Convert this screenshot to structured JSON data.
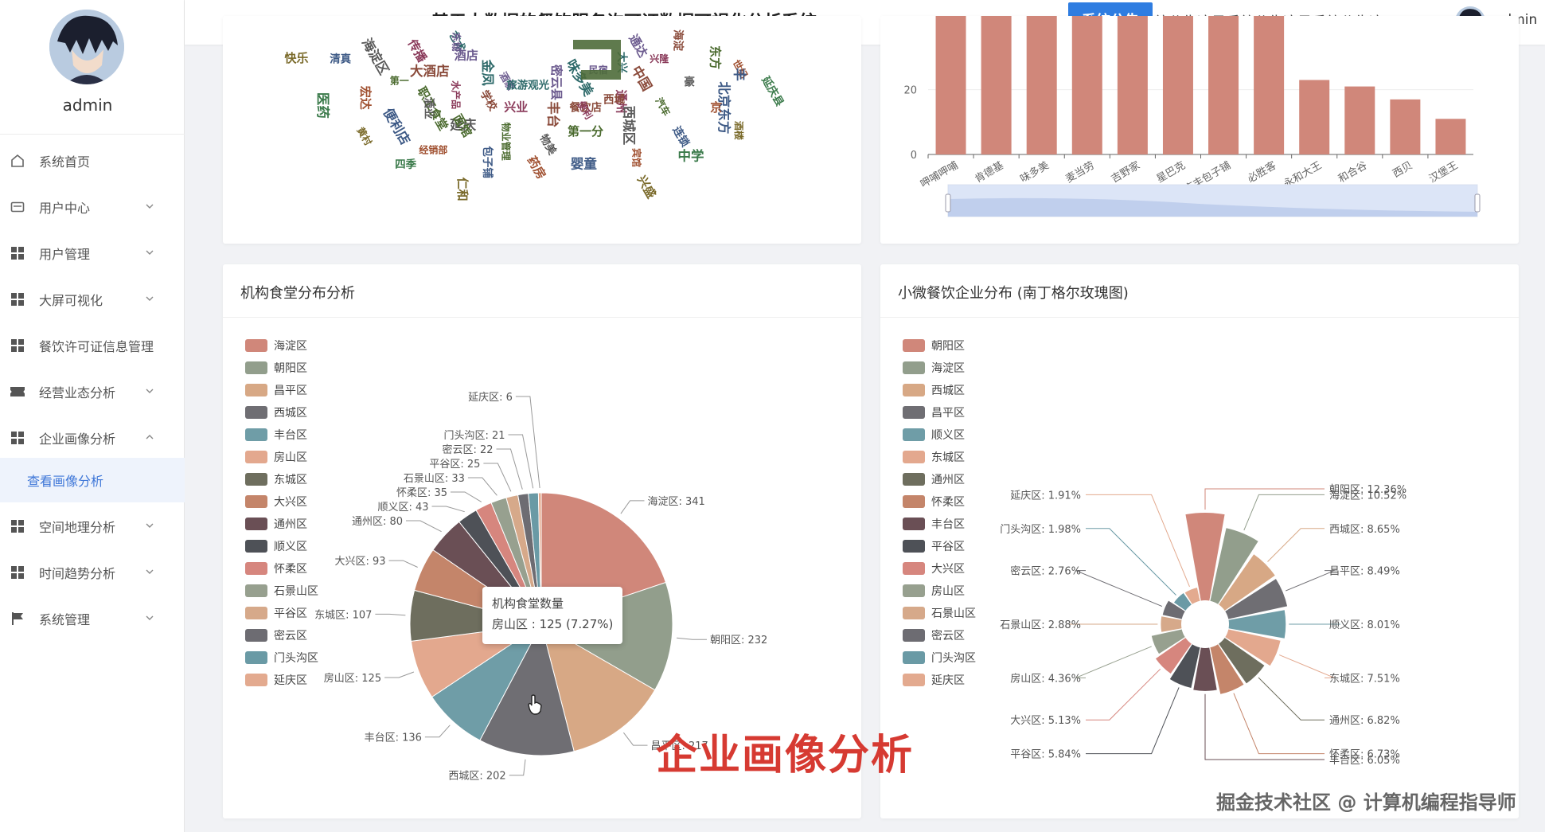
{
  "app": {
    "title": "基于大数据的餐饮服务许可证数据可视化分析系统",
    "notice_button": "系统公告",
    "notice_text": "统公告这是系统公告这是系统公告这是系统公",
    "username": "admin"
  },
  "sidebar": {
    "username": "admin",
    "items": [
      {
        "label": "系统首页",
        "icon": "home-icon"
      },
      {
        "label": "用户中心",
        "icon": "id-card-icon"
      },
      {
        "label": "用户管理",
        "icon": "grid-icon"
      },
      {
        "label": "大屏可视化",
        "icon": "grid-icon"
      },
      {
        "label": "餐饮许可证信息管理",
        "icon": "grid-icon"
      },
      {
        "label": "经营业态分析",
        "icon": "ticket-icon"
      },
      {
        "label": "企业画像分析",
        "icon": "grid-icon"
      },
      {
        "label": "查看画像分析",
        "icon": ""
      },
      {
        "label": "空间地理分析",
        "icon": "grid-icon"
      },
      {
        "label": "时间趋势分析",
        "icon": "grid-icon"
      },
      {
        "label": "系统管理",
        "icon": "flag-icon"
      }
    ]
  },
  "wordcloud": {
    "words": [
      "咨询",
      "餐饮店",
      "职工食堂",
      "北京东方",
      "海淀",
      "艺术",
      "通州",
      "延庆",
      "世纪",
      "昌平区",
      "酒店",
      "中国",
      "物业管理",
      "清真",
      "兴盛",
      "金凤",
      "兴隆",
      "物美",
      "宏达",
      "中学",
      "酒家",
      "海淀",
      "第一分",
      "便利店",
      "酒楼",
      "旅游观光",
      "传播",
      "西城区",
      "经销部",
      "延庆县",
      "密云县",
      "大酒店",
      "汽车",
      "包子铺",
      "快乐",
      "味多美",
      "水产品",
      "豪",
      "药房",
      "医药",
      "民宿",
      "学校",
      "东方",
      "婴童",
      "黄村",
      "大兴",
      "兴业",
      "海淀区",
      "宾馆",
      "四季",
      "通达",
      "丰台",
      "第一",
      "连锁",
      "仁和",
      "西餐",
      "便利",
      "酒业",
      "京",
      "食品",
      "东城",
      "西城",
      "面馆",
      "丰"
    ]
  },
  "top_bar_chart": {
    "chart_data": {
      "type": "bar",
      "categories": [
        "呷哺呷哺",
        "肯德基",
        "味多美",
        "麦当劳",
        "吉野家",
        "星巴克",
        "庆丰包子铺",
        "必胜客",
        "永和大王",
        "和合谷",
        "西贝",
        "汉堡王"
      ],
      "values": [
        45,
        45,
        45,
        45,
        45,
        45,
        45,
        45,
        23,
        21,
        17,
        11
      ],
      "yticks": [
        0,
        20
      ],
      "color": "#d0877a",
      "data_zoom": true
    }
  },
  "canteen_pie": {
    "title": "机构食堂分布分析",
    "chart_data": {
      "type": "pie",
      "series_name": "机构食堂数量",
      "labels": [
        "海淀区",
        "朝阳区",
        "昌平区",
        "西城区",
        "丰台区",
        "房山区",
        "东城区",
        "大兴区",
        "通州区",
        "顺义区",
        "怀柔区",
        "石景山区",
        "平谷区",
        "密云区",
        "门头沟区",
        "延庆区"
      ],
      "values": [
        341,
        232,
        217,
        202,
        136,
        125,
        107,
        93,
        80,
        43,
        35,
        33,
        25,
        22,
        21,
        6
      ],
      "colors": [
        "#d0877a",
        "#929e8c",
        "#d7a885",
        "#6f6e73",
        "#6f9da7",
        "#e3a88e",
        "#6e6e5e",
        "#c4856a",
        "#6a4f55",
        "#4e5157",
        "#d6867e",
        "#97a08f",
        "#d6a98a",
        "#6d6c72",
        "#6a9aa5",
        "#e3aa8f"
      ]
    },
    "tooltip": {
      "title": "机构食堂数量",
      "body": "房山区 : 125 (7.27%)"
    }
  },
  "rose_chart": {
    "title": "小微餐饮企业分布 (南丁格尔玫瑰图)",
    "chart_data": {
      "type": "pie",
      "rose": true,
      "labels": [
        "朝阳区",
        "海淀区",
        "西城区",
        "昌平区",
        "顺义区",
        "东城区",
        "通州区",
        "怀柔区",
        "丰台区",
        "平谷区",
        "大兴区",
        "房山区",
        "石景山区",
        "密云区",
        "门头沟区",
        "延庆区"
      ],
      "percents": [
        12.36,
        10.52,
        8.65,
        8.49,
        8.01,
        7.51,
        6.82,
        6.73,
        6.05,
        5.84,
        5.13,
        4.36,
        2.88,
        2.76,
        1.98,
        1.91
      ],
      "colors": [
        "#d0877a",
        "#929e8c",
        "#d7a885",
        "#6f6e73",
        "#6f9da7",
        "#e3a88e",
        "#6e6e5e",
        "#c4856a",
        "#6a4f55",
        "#4e5157",
        "#d6867e",
        "#97a08f",
        "#d6a98a",
        "#6d6c72",
        "#6a9aa5",
        "#e3aa8f"
      ]
    }
  },
  "overlay": {
    "title": "企业画像分析",
    "watermark": "掘金技术社区 @ 计算机编程指导师"
  }
}
